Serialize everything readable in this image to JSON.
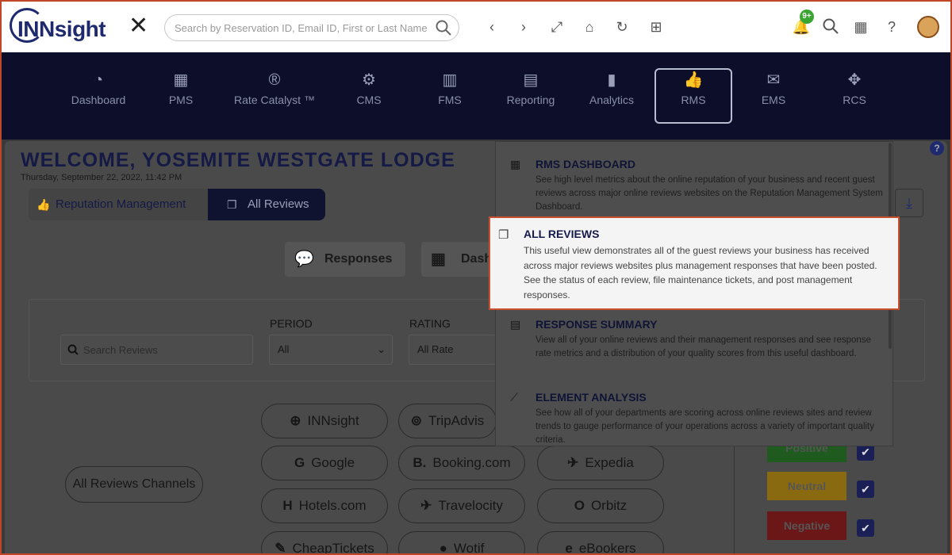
{
  "header": {
    "brand": "INNsight",
    "search_placeholder": "Search by Reservation ID, Email ID, First or Last Name",
    "notifications_count": "9+"
  },
  "modules": [
    {
      "label": "Dashboard",
      "icon": "dashboard-icon"
    },
    {
      "label": "PMS",
      "icon": "calendar-icon"
    },
    {
      "label": "Rate Catalyst ™",
      "icon": "rate-catalyst-icon"
    },
    {
      "label": "CMS",
      "icon": "gear-icon"
    },
    {
      "label": "FMS",
      "icon": "building-icon"
    },
    {
      "label": "Reporting",
      "icon": "document-icon"
    },
    {
      "label": "Analytics",
      "icon": "bar-chart-icon"
    },
    {
      "label": "RMS",
      "icon": "thumbs-up-icon",
      "active": true
    },
    {
      "label": "EMS",
      "icon": "envelope-icon"
    },
    {
      "label": "RCS",
      "icon": "move-icon"
    }
  ],
  "page": {
    "welcome": "WELCOME, YOSEMITE WESTGATE LODGE",
    "date": "Thursday, September 22, 2022, 11:42 PM",
    "breadcrumb": [
      "Reputation Management",
      "All Reviews"
    ],
    "tabs": {
      "responses": "Responses",
      "dashboard": "Dash"
    }
  },
  "filters": {
    "search_placeholder": "Search Reviews",
    "period_label": "PERIOD",
    "period_value": "All",
    "rating_label": "RATING",
    "rating_value": "All Rate"
  },
  "channels": {
    "all_label": "All Reviews Channels",
    "items": [
      "INNsight",
      "TripAdvis",
      "Google",
      "Booking.com",
      "Expedia",
      "Hotels.com",
      "Travelocity",
      "Orbitz",
      "CheapTickets",
      "Wotif",
      "eBookers"
    ]
  },
  "sentiment": [
    "Positive",
    "Neutral",
    "Negative"
  ],
  "sentiment_colors": {
    "positive": "#1f7a1f",
    "neutral": "#b8860b",
    "negative": "#8b1c1c"
  },
  "dropdown": {
    "items": [
      {
        "title": "RMS DASHBOARD",
        "desc": "See high level metrics about the online reputation of your business and recent guest reviews across major online reviews websites on the Reputation Management System Dashboard."
      },
      {
        "title": "ALL REVIEWS",
        "desc": "This useful view demonstrates all of the guest reviews your business has received across major reviews websites plus management responses that have been posted. See the status of each review, file maintenance tickets, and post management responses."
      },
      {
        "title": "RESPONSE SUMMARY",
        "desc": "View all of your online reviews and their management responses and see response rate metrics and a distribution of your quality scores from this useful dashboard."
      },
      {
        "title": "ELEMENT ANALYSIS",
        "desc": "See how all of your departments are scoring across online reviews sites and review trends to gauge performance of your operations across a variety of important quality criteria."
      }
    ]
  }
}
